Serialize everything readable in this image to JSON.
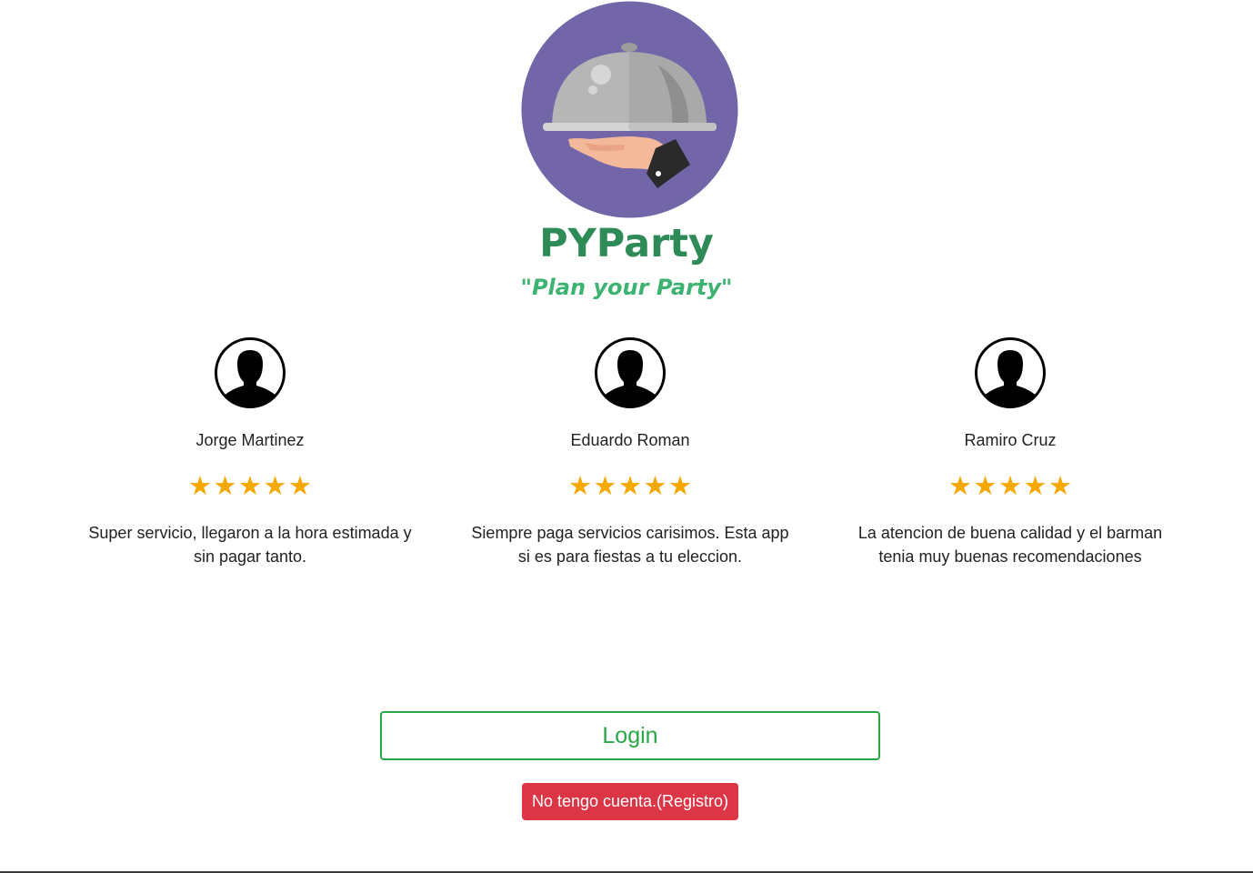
{
  "brand": {
    "name": "PYParty",
    "tagline": "\"Plan your Party\"",
    "logo_icon": "serving-cloche-icon",
    "colors": {
      "name": "#2e8b57",
      "tagline": "#3cb371",
      "logo_background": "#7266a8"
    }
  },
  "reviews": [
    {
      "name": "Jorge Martinez",
      "rating": 5,
      "stars": "★★★★★",
      "comment": "Super servicio, llegaron a la hora estimada y sin pagar tanto.",
      "avatar_icon": "user-avatar-icon"
    },
    {
      "name": "Eduardo Roman",
      "rating": 5,
      "stars": "★★★★★",
      "comment": "Siempre paga servicios carisimos. Esta app si es para fiestas a tu eleccion.",
      "avatar_icon": "user-avatar-icon"
    },
    {
      "name": "Ramiro Cruz",
      "rating": 5,
      "stars": "★★★★★",
      "comment": "La atencion de buena calidad y el barman tenia muy buenas recomendaciones",
      "avatar_icon": "user-avatar-icon"
    }
  ],
  "actions": {
    "login_label": "Login",
    "register_label": "No tengo cuenta.(Registro)",
    "colors": {
      "login": "#28a745",
      "register": "#dc3545",
      "stars": "#f5a800"
    }
  }
}
